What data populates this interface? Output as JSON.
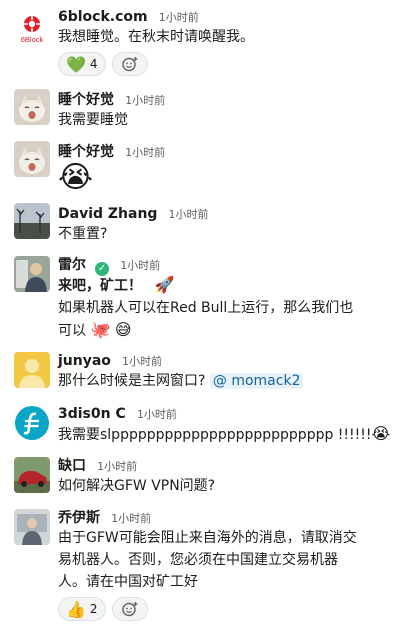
{
  "messages": [
    {
      "name": "6block.com",
      "time": "1小时前",
      "logo_text": "6Block",
      "text": "我想睡觉。在秋末时请唤醒我。",
      "reactions": [
        {
          "emoji": "💚",
          "count": "4"
        }
      ]
    },
    {
      "name": "睡个好觉",
      "time": "1小时前",
      "text": "我需要睡觉"
    },
    {
      "name": "睡个好觉",
      "time": "1小时前",
      "emoji": "😭"
    },
    {
      "name": "David Zhang",
      "time": "1小时前",
      "text": "不重置?"
    },
    {
      "name": "雷尔",
      "time": "1小时前",
      "title_text": "来吧，矿工！",
      "title_emoji": "🚀",
      "text": "如果机器人可以在Red Bull上运行，那么我们也",
      "text2": "可以",
      "text2_emoji1": "🐙",
      "text2_emoji2": "😅"
    },
    {
      "name": "junyao",
      "time": "1小时前",
      "text": "那什么时候是主网窗口?",
      "mention": "@ momack2"
    },
    {
      "name": "3dis0n C",
      "time": "1小时前",
      "text": "我需要slppppppppppppppppppppppppp !!!!!!",
      "emoji": "😭"
    },
    {
      "name": "缺口",
      "time": "1小时前",
      "text": "如何解决GFW VPN问题?"
    },
    {
      "name": "乔伊斯",
      "time": "1小时前",
      "lines": [
        "由于GFW可能会阻止来自海外的消息，请取消交",
        "易机器人。否则，您必须在中国建立交易机器",
        "人。请在中国对矿工好"
      ],
      "reactions": [
        {
          "emoji": "👍",
          "count": "2"
        }
      ]
    }
  ],
  "colors": {
    "text": "#1d1c1d",
    "muted": "#616061",
    "link": "#1264a3",
    "brand": "#e01e2d"
  }
}
